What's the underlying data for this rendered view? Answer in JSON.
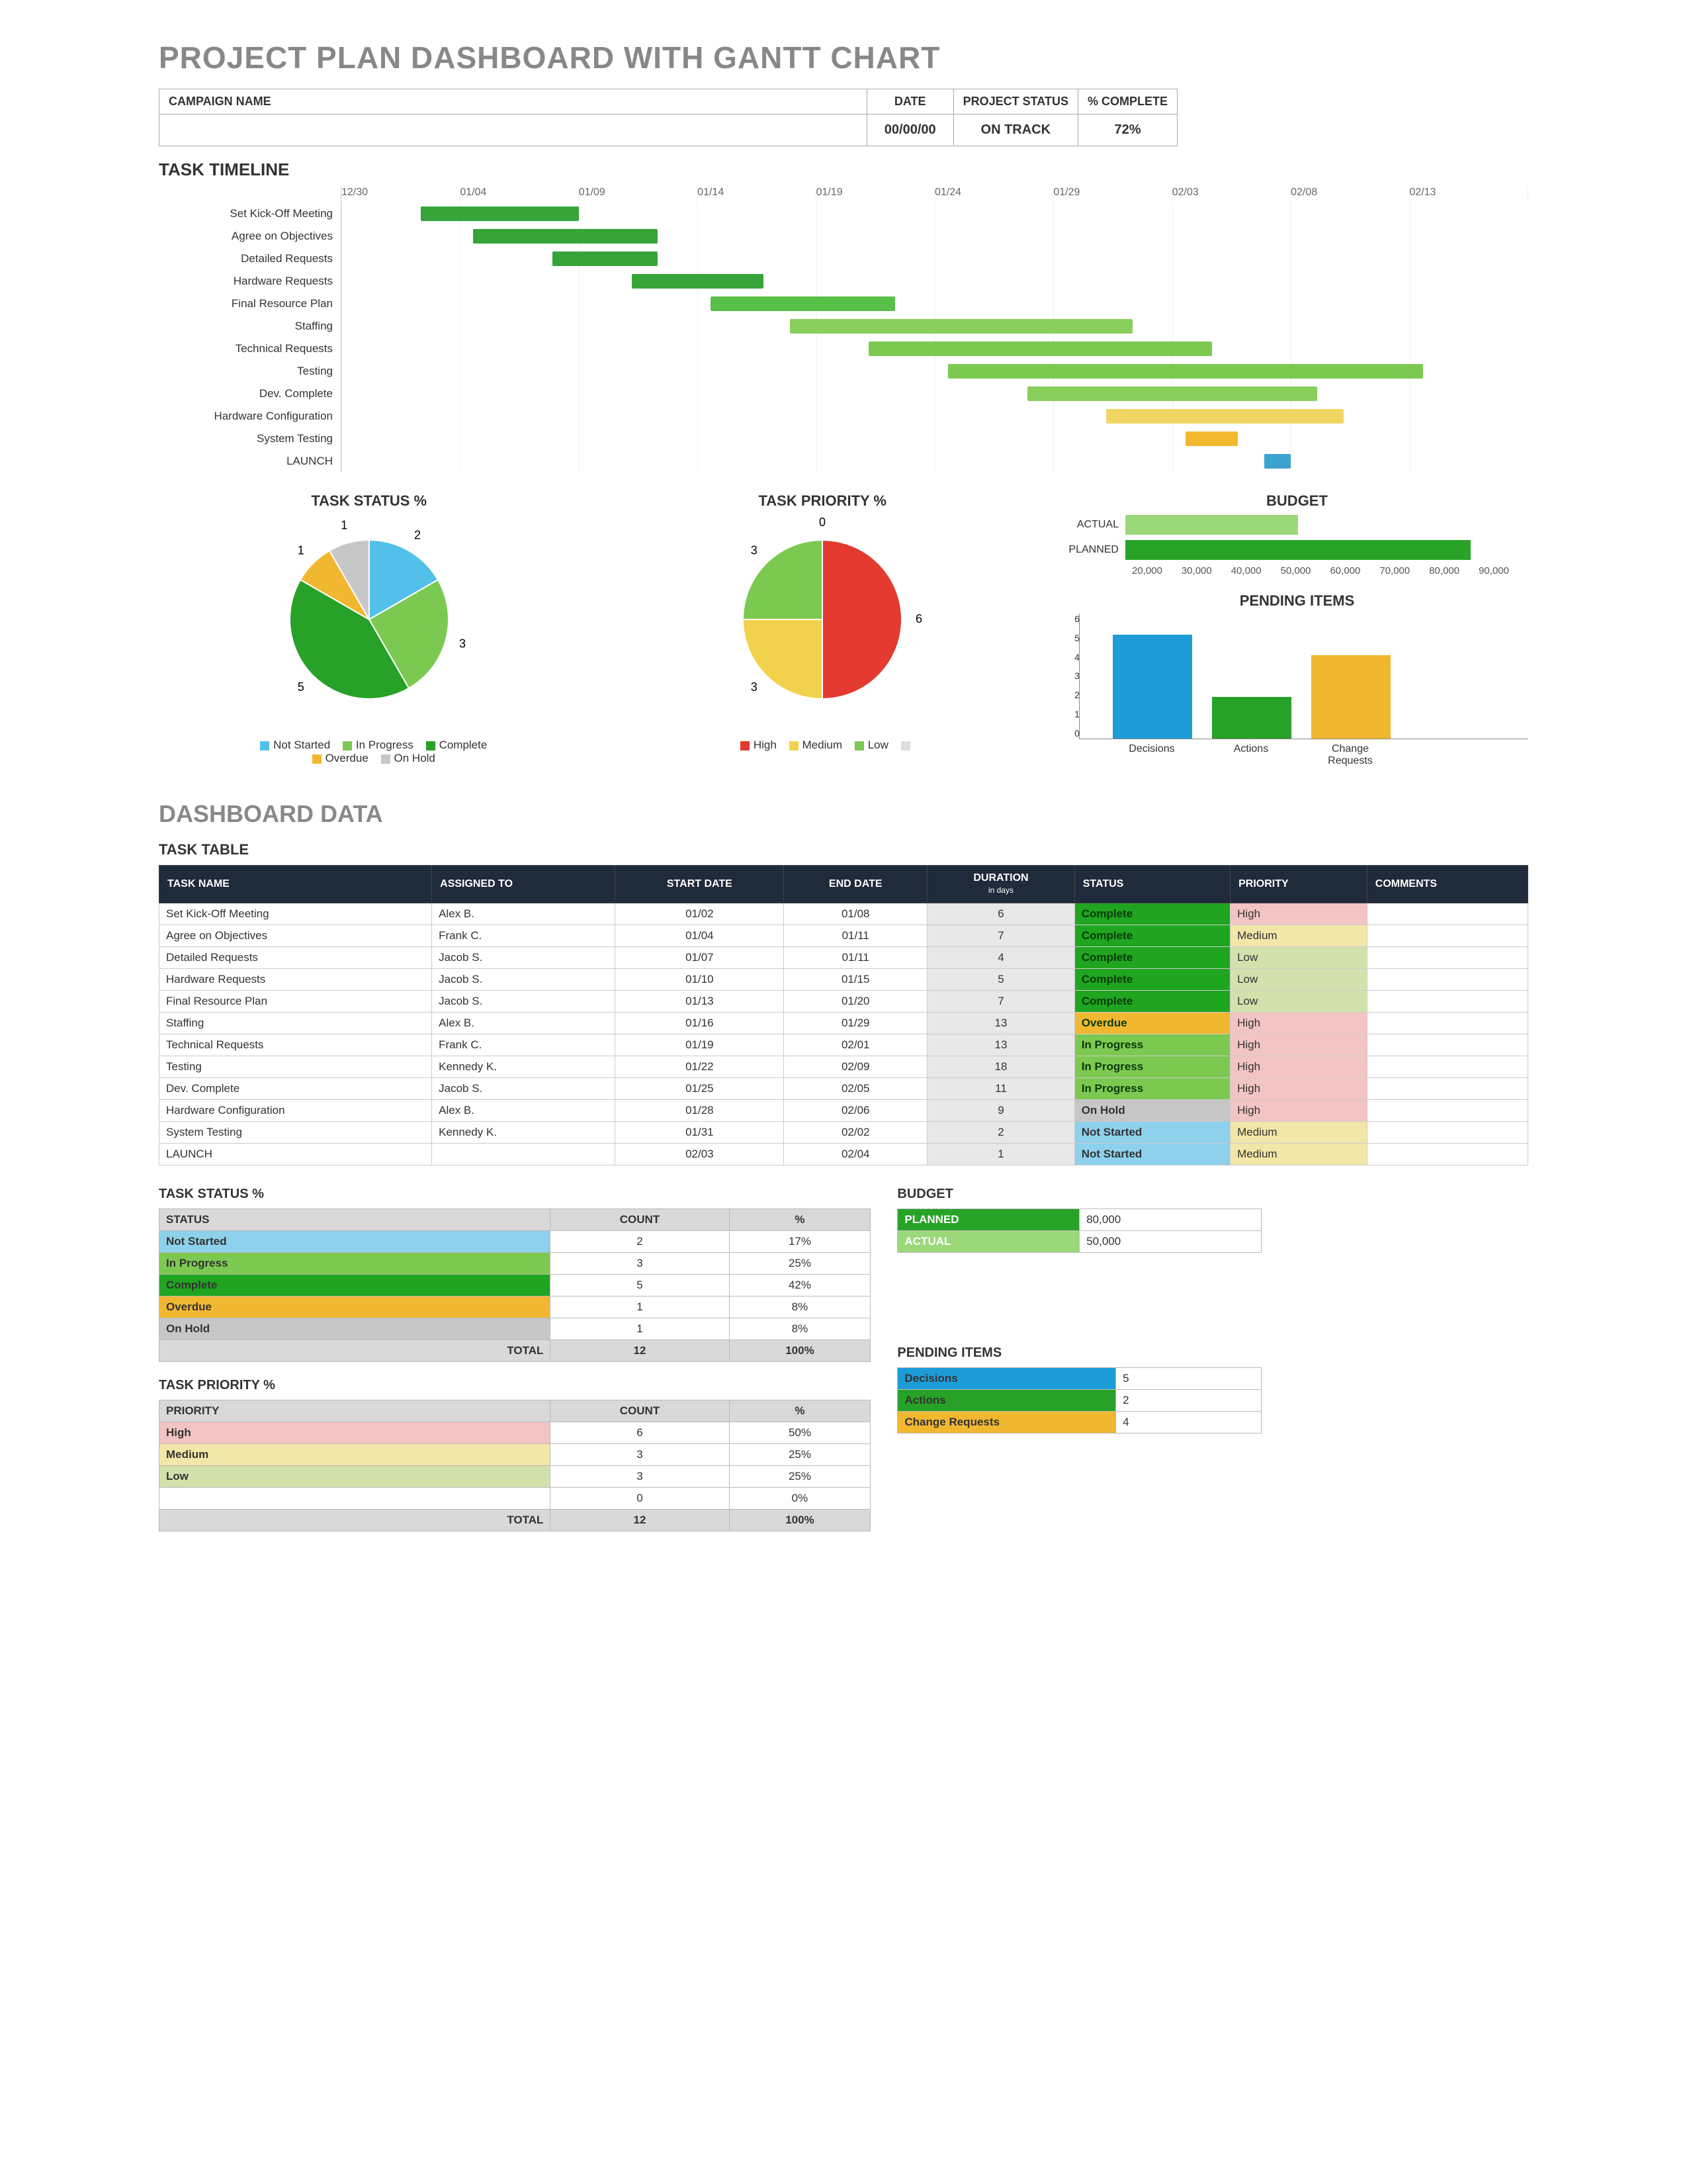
{
  "title": "PROJECT PLAN DASHBOARD WITH GANTT CHART",
  "header": {
    "campaign_label": "CAMPAIGN NAME",
    "date_label": "DATE",
    "date_value": "00/00/00",
    "status_label": "PROJECT STATUS",
    "status_value": "ON TRACK",
    "complete_label": "% COMPLETE",
    "complete_value": "72%"
  },
  "gantt": {
    "title": "TASK TIMELINE",
    "start": "12/30",
    "ticks": [
      "12/30",
      "01/04",
      "01/09",
      "01/14",
      "01/19",
      "01/24",
      "01/29",
      "02/03",
      "02/08",
      "02/13"
    ],
    "tasks": [
      {
        "name": "Set Kick-Off Meeting",
        "start": 3,
        "dur": 6,
        "color": "#37a43a"
      },
      {
        "name": "Agree on Objectives",
        "start": 5,
        "dur": 7,
        "color": "#37a43a"
      },
      {
        "name": "Detailed Requests",
        "start": 8,
        "dur": 4,
        "color": "#37a43a"
      },
      {
        "name": "Hardware Requests",
        "start": 11,
        "dur": 5,
        "color": "#37a43a"
      },
      {
        "name": "Final Resource Plan",
        "start": 14,
        "dur": 7,
        "color": "#58bf48"
      },
      {
        "name": "Staffing",
        "start": 17,
        "dur": 13,
        "color": "#89cf5e"
      },
      {
        "name": "Technical Requests",
        "start": 20,
        "dur": 13,
        "color": "#7cc951"
      },
      {
        "name": "Testing",
        "start": 23,
        "dur": 18,
        "color": "#7cc951"
      },
      {
        "name": "Dev. Complete",
        "start": 26,
        "dur": 11,
        "color": "#89cf5e"
      },
      {
        "name": "Hardware Configuration",
        "start": 29,
        "dur": 9,
        "color": "#f1d664"
      },
      {
        "name": "System Testing",
        "start": 32,
        "dur": 2,
        "color": "#f2b830"
      },
      {
        "name": "LAUNCH",
        "start": 35,
        "dur": 1,
        "color": "#3ba3d0"
      }
    ],
    "range_days": 45
  },
  "chart_data": [
    {
      "id": "task_status_pie",
      "type": "pie",
      "title": "TASK STATUS %",
      "series": [
        {
          "name": "Not Started",
          "value": 2,
          "color": "#52c0e8"
        },
        {
          "name": "In Progress",
          "value": 3,
          "color": "#7cc951"
        },
        {
          "name": "Complete",
          "value": 5,
          "color": "#27a127"
        },
        {
          "name": "Overdue",
          "value": 1,
          "color": "#f2b730"
        },
        {
          "name": "On Hold",
          "value": 1,
          "color": "#c7c7c7"
        }
      ]
    },
    {
      "id": "task_priority_pie",
      "type": "pie",
      "title": "TASK PRIORITY %",
      "series": [
        {
          "name": "High",
          "value": 6,
          "color": "#e43a2f"
        },
        {
          "name": "Medium",
          "value": 3,
          "color": "#f2d24d"
        },
        {
          "name": "Low",
          "value": 3,
          "color": "#7cc951"
        },
        {
          "name": "",
          "value": 0,
          "color": "#dddddd"
        }
      ]
    },
    {
      "id": "budget_bar",
      "type": "bar",
      "title": "BUDGET",
      "orientation": "horizontal",
      "categories": [
        "ACTUAL",
        "PLANNED"
      ],
      "values": [
        50000,
        80000
      ],
      "colors": [
        "#9ad87a",
        "#28a328"
      ],
      "xlim": [
        20000,
        90000
      ]
    },
    {
      "id": "pending_items",
      "type": "bar",
      "title": "PENDING ITEMS",
      "categories": [
        "Decisions",
        "Actions",
        "Change Requests"
      ],
      "values": [
        5,
        2,
        4
      ],
      "colors": [
        "#1d9cd8",
        "#27a127",
        "#f2b730"
      ],
      "ylim": [
        0,
        6
      ]
    }
  ],
  "legends": {
    "status": [
      "Not Started",
      "In Progress",
      "Complete",
      "Overdue",
      "On Hold"
    ],
    "priority": [
      "High",
      "Medium",
      "Low",
      ""
    ]
  },
  "dashboard_data_title": "DASHBOARD DATA",
  "task_table": {
    "title": "TASK TABLE",
    "headers": [
      "TASK NAME",
      "ASSIGNED TO",
      "START DATE",
      "END DATE",
      "DURATION in days",
      "STATUS",
      "PRIORITY",
      "COMMENTS"
    ],
    "rows": [
      {
        "name": "Set Kick-Off Meeting",
        "assigned": "Alex B.",
        "start": "01/02",
        "end": "01/08",
        "dur": "6",
        "status": "Complete",
        "status_color": "#1fa51f",
        "priority": "High",
        "pri_color": "#f3c4c4"
      },
      {
        "name": "Agree on Objectives",
        "assigned": "Frank C.",
        "start": "01/04",
        "end": "01/11",
        "dur": "7",
        "status": "Complete",
        "status_color": "#1fa51f",
        "priority": "Medium",
        "pri_color": "#f2e6a8"
      },
      {
        "name": "Detailed Requests",
        "assigned": "Jacob S.",
        "start": "01/07",
        "end": "01/11",
        "dur": "4",
        "status": "Complete",
        "status_color": "#1fa51f",
        "priority": "Low",
        "pri_color": "#d3e2ad"
      },
      {
        "name": "Hardware Requests",
        "assigned": "Jacob S.",
        "start": "01/10",
        "end": "01/15",
        "dur": "5",
        "status": "Complete",
        "status_color": "#1fa51f",
        "priority": "Low",
        "pri_color": "#d3e2ad"
      },
      {
        "name": "Final Resource Plan",
        "assigned": "Jacob S.",
        "start": "01/13",
        "end": "01/20",
        "dur": "7",
        "status": "Complete",
        "status_color": "#1fa51f",
        "priority": "Low",
        "pri_color": "#d3e2ad"
      },
      {
        "name": "Staffing",
        "assigned": "Alex B.",
        "start": "01/16",
        "end": "01/29",
        "dur": "13",
        "status": "Overdue",
        "status_color": "#f2b730",
        "priority": "High",
        "pri_color": "#f3c4c4"
      },
      {
        "name": "Technical Requests",
        "assigned": "Frank C.",
        "start": "01/19",
        "end": "02/01",
        "dur": "13",
        "status": "In Progress",
        "status_color": "#7cc951",
        "priority": "High",
        "pri_color": "#f3c4c4"
      },
      {
        "name": "Testing",
        "assigned": "Kennedy K.",
        "start": "01/22",
        "end": "02/09",
        "dur": "18",
        "status": "In Progress",
        "status_color": "#7cc951",
        "priority": "High",
        "pri_color": "#f3c4c4"
      },
      {
        "name": "Dev. Complete",
        "assigned": "Jacob S.",
        "start": "01/25",
        "end": "02/05",
        "dur": "11",
        "status": "In Progress",
        "status_color": "#7cc951",
        "priority": "High",
        "pri_color": "#f3c4c4"
      },
      {
        "name": "Hardware Configuration",
        "assigned": "Alex B.",
        "start": "01/28",
        "end": "02/06",
        "dur": "9",
        "status": "On Hold",
        "status_color": "#c7c7c7",
        "priority": "High",
        "pri_color": "#f3c4c4"
      },
      {
        "name": "System Testing",
        "assigned": "Kennedy K.",
        "start": "01/31",
        "end": "02/02",
        "dur": "2",
        "status": "Not Started",
        "status_color": "#8dd1ec",
        "priority": "Medium",
        "pri_color": "#f2e6a8"
      },
      {
        "name": "LAUNCH",
        "assigned": "",
        "start": "02/03",
        "end": "02/04",
        "dur": "1",
        "status": "Not Started",
        "status_color": "#8dd1ec",
        "priority": "Medium",
        "pri_color": "#f2e6a8"
      }
    ]
  },
  "status_summary": {
    "title": "TASK STATUS %",
    "headers": [
      "STATUS",
      "COUNT",
      "%"
    ],
    "rows": [
      {
        "label": "Not Started",
        "count": "2",
        "pct": "17%",
        "color": "#8dd1ec"
      },
      {
        "label": "In Progress",
        "count": "3",
        "pct": "25%",
        "color": "#7cc951"
      },
      {
        "label": "Complete",
        "count": "5",
        "pct": "42%",
        "color": "#1fa51f"
      },
      {
        "label": "Overdue",
        "count": "1",
        "pct": "8%",
        "color": "#f2b730"
      },
      {
        "label": "On Hold",
        "count": "1",
        "pct": "8%",
        "color": "#c7c7c7"
      }
    ],
    "total_label": "TOTAL",
    "total_count": "12",
    "total_pct": "100%"
  },
  "priority_summary": {
    "title": "TASK PRIORITY %",
    "headers": [
      "PRIORITY",
      "COUNT",
      "%"
    ],
    "rows": [
      {
        "label": "High",
        "count": "6",
        "pct": "50%",
        "color": "#f3c4c4"
      },
      {
        "label": "Medium",
        "count": "3",
        "pct": "25%",
        "color": "#f2e6a8"
      },
      {
        "label": "Low",
        "count": "3",
        "pct": "25%",
        "color": "#d3e2ad"
      },
      {
        "label": "",
        "count": "0",
        "pct": "0%",
        "color": "#ffffff"
      }
    ],
    "total_label": "TOTAL",
    "total_count": "12",
    "total_pct": "100%"
  },
  "budget_summary": {
    "title": "BUDGET",
    "rows": [
      {
        "label": "PLANNED",
        "value": "80,000",
        "color": "#28a328"
      },
      {
        "label": "ACTUAL",
        "value": "50,000",
        "color": "#9ad87a"
      }
    ]
  },
  "pending_summary": {
    "title": "PENDING ITEMS",
    "rows": [
      {
        "label": "Decisions",
        "value": "5",
        "color": "#1d9cd8"
      },
      {
        "label": "Actions",
        "value": "2",
        "color": "#27a127"
      },
      {
        "label": "Change Requests",
        "value": "4",
        "color": "#f2b730"
      }
    ]
  }
}
